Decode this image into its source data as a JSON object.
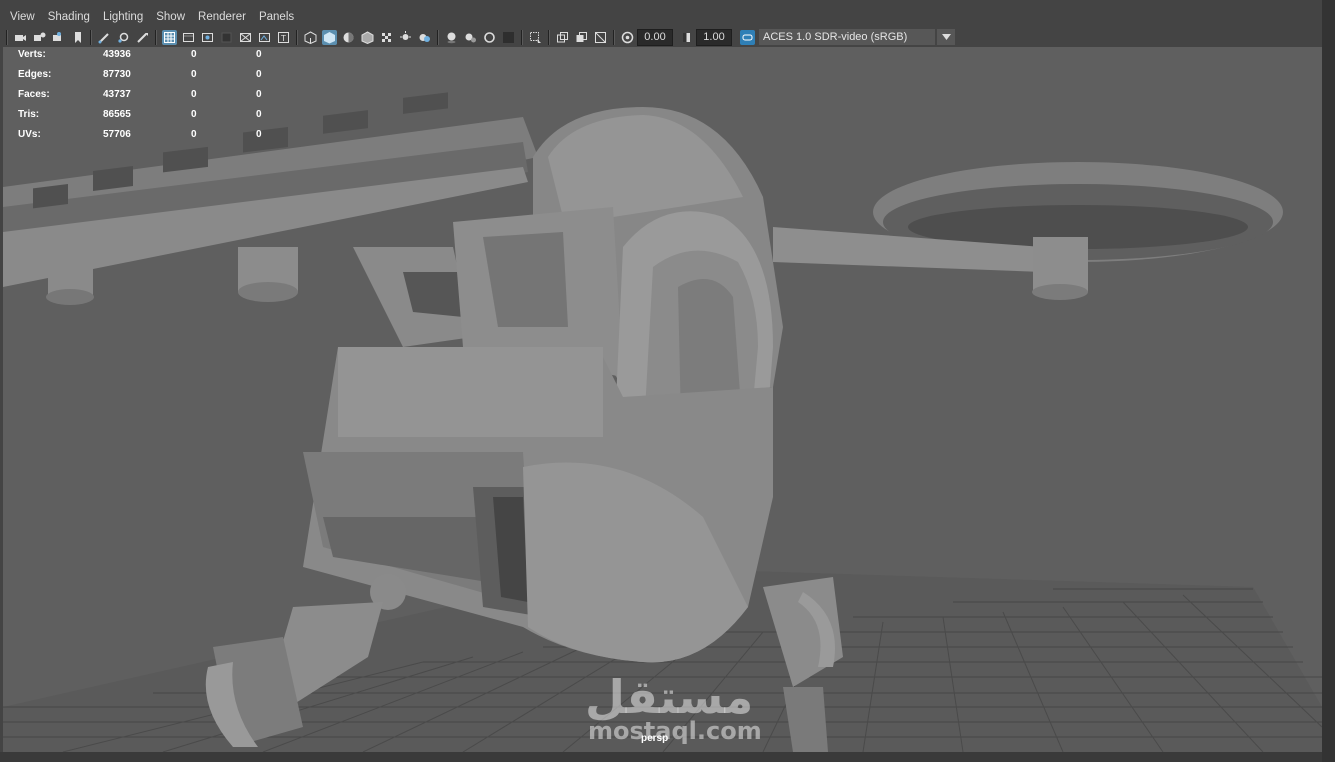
{
  "menu": {
    "items": [
      {
        "label": "View"
      },
      {
        "label": "Shading"
      },
      {
        "label": "Lighting"
      },
      {
        "label": "Show"
      },
      {
        "label": "Renderer"
      },
      {
        "label": "Panels"
      }
    ]
  },
  "toolbar": {
    "exposure_value": "0.00",
    "gamma_value": "1.00",
    "color_space": "ACES 1.0 SDR-video (sRGB)",
    "icons": [
      "select-camera-icon",
      "camera-attributes-icon",
      "bookmarks-icon",
      "image-plane-icon",
      "grease-pencil-icon",
      "2d-pan-zoom-icon",
      "grid-icon",
      "film-gate-icon",
      "resolution-gate-icon",
      "gate-mask-icon",
      "field-chart-icon",
      "safe-action-icon",
      "safe-title-icon",
      "wireframe-icon",
      "smooth-shade-icon",
      "default-material-icon",
      "textured-icon",
      "use-all-lights-icon",
      "shadows-icon",
      "ambient-occlusion-icon",
      "motion-blur-icon",
      "anti-aliasing-icon",
      "depth-of-field-icon",
      "isolate-select-icon",
      "xray-icon",
      "xray-joints-icon",
      "xray-components-icon",
      "backface-culling-icon"
    ],
    "accent": "#5b8fb0"
  },
  "hud": {
    "rows": [
      {
        "label": "Verts:",
        "v1": "43936",
        "v2": "0",
        "v3": "0"
      },
      {
        "label": "Edges:",
        "v1": "87730",
        "v2": "0",
        "v3": "0"
      },
      {
        "label": "Faces:",
        "v1": "43737",
        "v2": "0",
        "v3": "0"
      },
      {
        "label": "Tris:",
        "v1": "86565",
        "v2": "0",
        "v3": "0"
      },
      {
        "label": "UVs:",
        "v1": "57706",
        "v2": "0",
        "v3": "0"
      }
    ]
  },
  "viewport": {
    "camera": "persp",
    "background": "#5f5f5f",
    "model_color": "#7a7a7a"
  },
  "watermark": {
    "arabic": "مستقل",
    "url": "mostaql.com"
  }
}
